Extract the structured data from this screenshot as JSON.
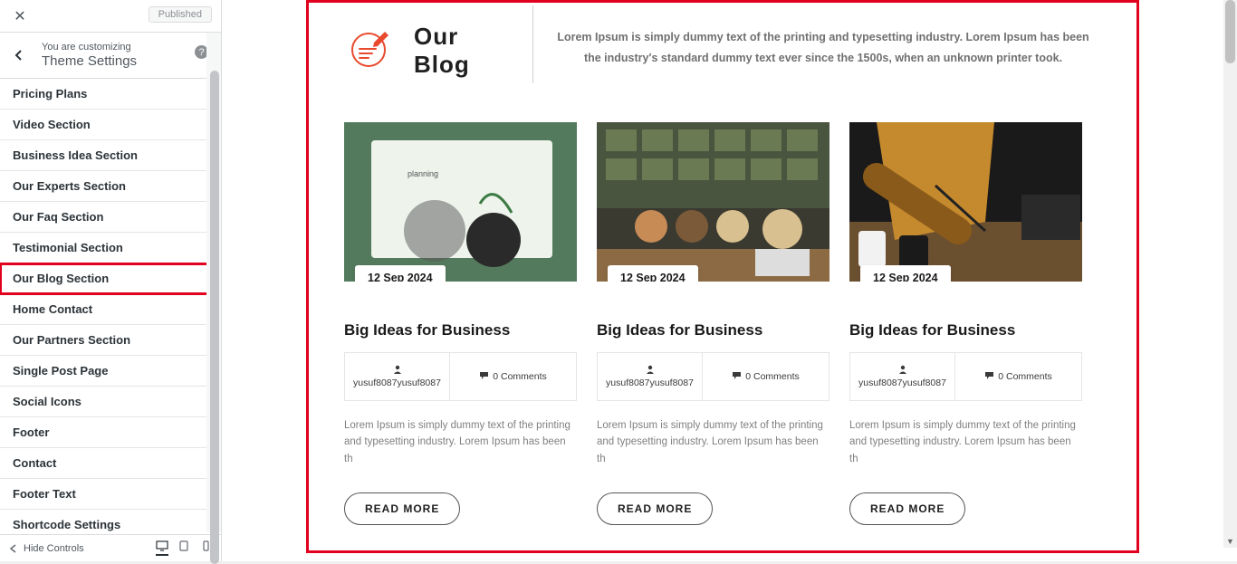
{
  "sidebar": {
    "published_label": "Published",
    "you_are_customizing": "You are customizing",
    "section_name": "Theme Settings",
    "hide_controls": "Hide Controls",
    "items": [
      {
        "label": "Pricing Plans"
      },
      {
        "label": "Video Section"
      },
      {
        "label": "Business Idea Section"
      },
      {
        "label": "Our Experts Section"
      },
      {
        "label": "Our Faq Section"
      },
      {
        "label": "Testimonial Section"
      },
      {
        "label": "Our Blog Section"
      },
      {
        "label": "Home Contact"
      },
      {
        "label": "Our Partners Section"
      },
      {
        "label": "Single Post Page"
      },
      {
        "label": "Social Icons"
      },
      {
        "label": "Footer"
      },
      {
        "label": "Contact"
      },
      {
        "label": "Footer Text"
      },
      {
        "label": "Shortcode Settings"
      }
    ]
  },
  "blog": {
    "title_line1": "Our",
    "title_line2": "Blog",
    "description": "Lorem Ipsum is simply dummy text of the printing and typesetting industry. Lorem Ipsum has been the industry's standard dummy text ever since the 1500s, when an unknown printer took."
  },
  "posts": [
    {
      "date": "12 Sep 2024",
      "title": "Big Ideas for Business",
      "author": "yusuf8087yusuf8087",
      "comments": "0 Comments",
      "excerpt": "Lorem Ipsum is simply dummy text of the printing and typesetting industry. Lorem Ipsum has been th",
      "read_more": "READ MORE"
    },
    {
      "date": "12 Sep 2024",
      "title": "Big Ideas for Business",
      "author": "yusuf8087yusuf8087",
      "comments": "0 Comments",
      "excerpt": "Lorem Ipsum is simply dummy text of the printing and typesetting industry. Lorem Ipsum has been th",
      "read_more": "READ MORE"
    },
    {
      "date": "12 Sep 2024",
      "title": "Big Ideas for Business",
      "author": "yusuf8087yusuf8087",
      "comments": "0 Comments",
      "excerpt": "Lorem Ipsum is simply dummy text of the printing and typesetting industry. Lorem Ipsum has been th",
      "read_more": "READ MORE"
    }
  ]
}
